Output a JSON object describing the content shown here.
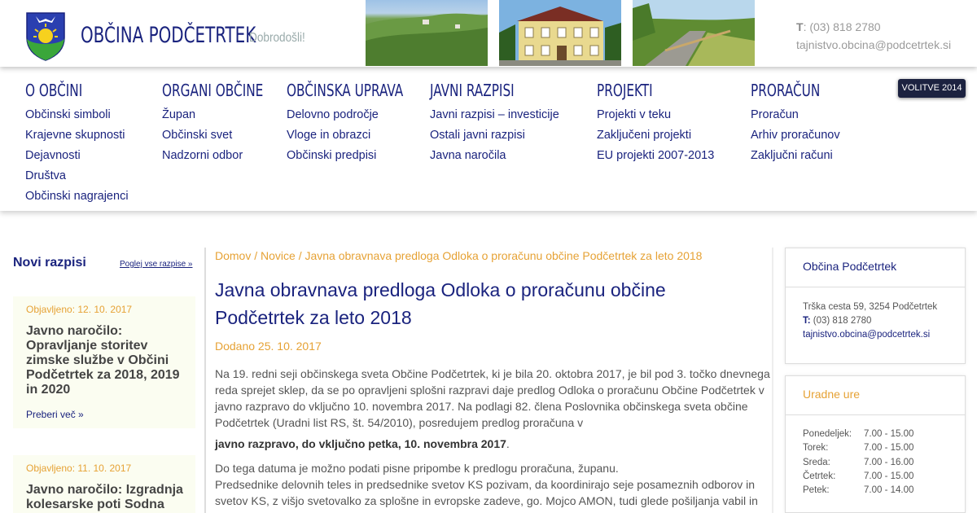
{
  "header": {
    "title": "OBČINA PODČETRTEK",
    "welcome": "Dobrodošli!",
    "phone_label": "T",
    "phone": ": (03) 818 2780",
    "email": "tajnistvo.obcina@podcetrtek.si"
  },
  "nav": {
    "columns": [
      {
        "heading": "O OBČINI",
        "links": [
          "Občinski simboli",
          "Krajevne skupnosti",
          "Dejavnosti",
          "Društva",
          "Občinski nagrajenci"
        ]
      },
      {
        "heading": "ORGANI OBČINE",
        "links": [
          "Župan",
          "Občinski svet",
          "Nadzorni odbor"
        ]
      },
      {
        "heading": "OBČINSKA UPRAVA",
        "links": [
          "Delovno področje",
          "Vloge in obrazci",
          "Občinski predpisi"
        ]
      },
      {
        "heading": "JAVNI RAZPISI",
        "links": [
          "Javni razpisi – investicije",
          "Ostali javni razpisi",
          "Javna naročila"
        ]
      },
      {
        "heading": "PROJEKTI",
        "links": [
          "Projekti v teku",
          "Zaključeni projekti",
          "EU projekti 2007-2013"
        ]
      },
      {
        "heading": "PRORAČUN",
        "links": [
          "Proračun",
          "Arhiv proračunov",
          "Zaključni računi"
        ]
      }
    ],
    "volitve": "VOLITVE 2014"
  },
  "left": {
    "title": "Novi razpisi",
    "view_all": "Poglej vse razpise »",
    "cards": [
      {
        "date": "Objavljeno: 12. 10. 2017",
        "title": "Javno naročilo: Opravljanje storitev zimske službe v Občini Podčetrtek za 2018, 2019 in 2020",
        "more": "Preberi več »"
      },
      {
        "date": "Objavljeno: 11. 10. 2017",
        "title": "Javno naročilo: Izgradnja kolesarske poti Sodna",
        "more": ""
      }
    ]
  },
  "main": {
    "breadcrumb": "Domov / Novice / Javna obravnava predloga Odloka o proračunu občine Podčetrtek za leto 2018",
    "title": "Javna obravnava predloga Odloka o proračunu občine Podčetrtek za leto 2018",
    "added": "Dodano 25. 10. 2017",
    "p1": "Na 19. redni seji občinskega sveta Občine Podčetrtek, ki je bila 20. oktobra 2017, je bil pod 3. točko dnevnega reda sprejet  sklep, da se po opravljeni splošni razpravi daje predlog Odloka o proračunu Občine Podčetrtek v javno razpravo do vključno 10. novembra 2017. Na podlagi  82. člena Poslovnika občinskega sveta občine Podčetrtek (Uradni list RS, št. 54/2010), posredujem predlog proračuna v",
    "p2_bold": "javno razpravo, do vključno petka, 10. novembra 2017",
    "p2_end": ".",
    "p3": "Do tega datuma je možno podati pisne pripombe k predlogu proračuna, županu.",
    "p4": "Predsednike delovnih teles in predsednike svetov KS pozivam, da koordinirajo seje posameznih odborov in svetov KS, z višjo  svetovalko za splošne in evropske zadeve, go. Mojco AMON, tudi glede pošiljanja vabil in"
  },
  "right": {
    "box1": {
      "title": "Občina Podčetrtek",
      "address": "Trška cesta 59, 3254 Podčetrtek",
      "phone_label": "T:",
      "phone": " (03) 818 2780",
      "email": "tajnistvo.obcina@podcetrtek.si"
    },
    "box2": {
      "title": "Uradne ure",
      "hours": [
        {
          "day": "Ponedeljek:",
          "time": "7.00 - 15.00"
        },
        {
          "day": "Torek:",
          "time": "7.00 - 15.00"
        },
        {
          "day": "Sreda:",
          "time": "7.00 - 16.00"
        },
        {
          "day": "Četrtek:",
          "time": "7.00 - 15.00"
        },
        {
          "day": "Petek:",
          "time": "7.00 - 14.00"
        }
      ]
    }
  },
  "colors": {
    "navy": "#1a237e",
    "orange": "#e6a235",
    "crest_blue": "#2a3fb0",
    "crest_green": "#3aa63a",
    "crest_yellow": "#f6d11e"
  }
}
